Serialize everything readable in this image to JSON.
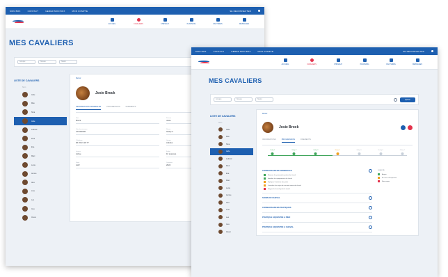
{
  "colors": {
    "brand": "#1d5fb0",
    "accent": "#e3324c",
    "success": "#3ea55a",
    "warning": "#f0a020",
    "background": "#edf1f6"
  },
  "topbar": {
    "links": [
      "MON BOX",
      "CONTACT",
      "GERER MON BOX",
      "MON COMPTE"
    ],
    "right": "SE DECONNECTER"
  },
  "nav": {
    "items": [
      {
        "label": "ACCUEIL",
        "icon": "home-icon"
      },
      {
        "label": "CAVALIERS",
        "icon": "riders-icon"
      },
      {
        "label": "CHEVAUX",
        "icon": "horse-icon"
      },
      {
        "label": "PLANNING",
        "icon": "calendar-icon"
      },
      {
        "label": "FACTURES",
        "icon": "invoice-icon"
      },
      {
        "label": "MESSAGES",
        "icon": "message-icon"
      }
    ]
  },
  "page": {
    "title": "MES CAVALIERS"
  },
  "filters": [
    "Groupe",
    "Niveau",
    "Statut"
  ],
  "add_label": "Ajouter",
  "side": {
    "title": "LISTE DE CAVALIERS",
    "header": "Nom"
  },
  "horses": [
    "Jade",
    "Max",
    "Nina",
    "Jade",
    "Ludovic",
    "Paul",
    "Eva",
    "Marc",
    "Lucie",
    "Aurore",
    "Alex",
    "Lina",
    "Leo",
    "Ines",
    "Oscar"
  ],
  "profile": {
    "crumb": "Retour",
    "name": "Josie Brock"
  },
  "win1": {
    "tabs": [
      "INFORMATIONS GENERALES",
      "PROGRESSION",
      "PAIEMENTS"
    ],
    "fields": [
      {
        "label": "Nom",
        "value": "Brock"
      },
      {
        "label": "Prénom",
        "value": "Josie"
      },
      {
        "label": "Date de naissance",
        "value": "12/04/2006"
      },
      {
        "label": "Niveau",
        "value": "Galop 4"
      },
      {
        "label": "Téléphone",
        "value": "06 45 23 18 77"
      },
      {
        "label": "Groupe",
        "value": "Adultes"
      },
      {
        "label": "Licence",
        "value": "Active"
      },
      {
        "label": "Forfait",
        "value": "10 séances"
      },
      {
        "label": "Statut",
        "value": "Actif"
      },
      {
        "label": "Cotisation",
        "value": "2024"
      }
    ]
  },
  "win2": {
    "tabs": [
      "INFORMATIONS",
      "PROGRESSION",
      "PAIEMENTS"
    ],
    "steps": [
      "Galop 1",
      "Galop 2",
      "Galop 3",
      "Galop 4",
      "Galop 5",
      "Galop 6",
      "Galop 7"
    ],
    "sections": [
      {
        "title": "CONNAISSANCES GENERALES",
        "criteria": [
          {
            "status": "g",
            "text": "Nommer les principales parties du cheval"
          },
          {
            "status": "g",
            "text": "Identifier les équipements du cheval"
          },
          {
            "status": "o",
            "text": "Expliquer l'entretien des pieds"
          },
          {
            "status": "o",
            "text": "Connaître les règles de sécurité autour du cheval"
          },
          {
            "status": "r",
            "text": "Soigner le cheval après le travail"
          }
        ]
      },
      {
        "title": "SOINS DU CHEVAL",
        "criteria": []
      },
      {
        "title": "CONNAISSANCES PRATIQUES",
        "criteria": []
      },
      {
        "title": "PRATIQUE EQUESTRE A PIED",
        "criteria": []
      },
      {
        "title": "PRATIQUE EQUESTRE A CHEVAL",
        "criteria": []
      }
    ],
    "legend": {
      "title": "Légende",
      "items": [
        {
          "status": "g",
          "text": "Acquis"
        },
        {
          "status": "o",
          "text": "En cours d'acquisition"
        },
        {
          "status": "r",
          "text": "Non acquis"
        }
      ]
    }
  }
}
